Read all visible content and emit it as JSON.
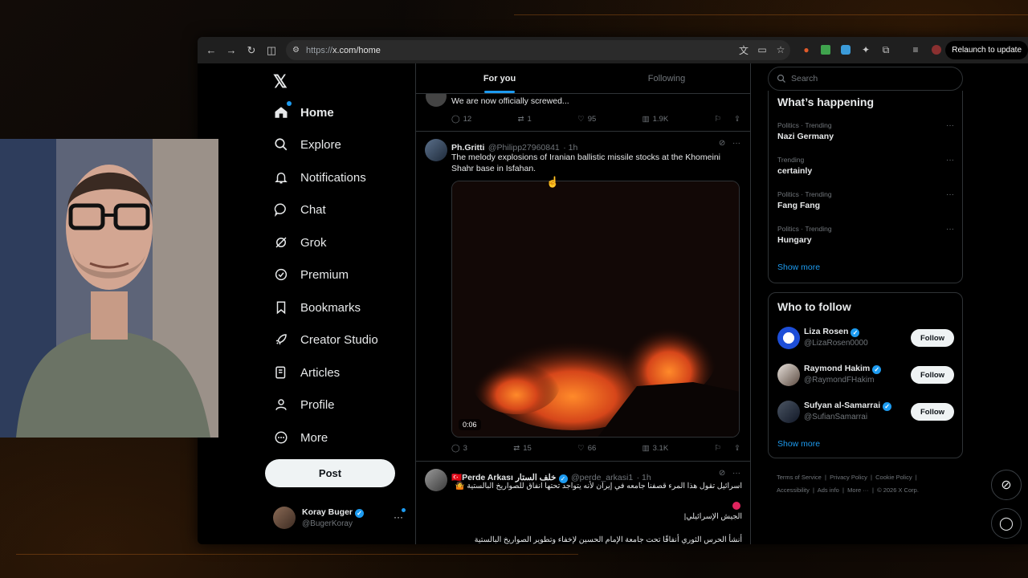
{
  "browser": {
    "url_prefix": "https://",
    "url_main": "x.com/home",
    "relaunch_label": "Relaunch to update"
  },
  "nav": {
    "logo": "𝕏",
    "items": [
      {
        "label": "Home",
        "icon": "home-icon"
      },
      {
        "label": "Explore",
        "icon": "search-icon"
      },
      {
        "label": "Notifications",
        "icon": "bell-icon"
      },
      {
        "label": "Chat",
        "icon": "chat-bubble-icon"
      },
      {
        "label": "Grok",
        "icon": "grok-icon"
      },
      {
        "label": "Premium",
        "icon": "verified-badge-icon"
      },
      {
        "label": "Bookmarks",
        "icon": "bookmark-icon"
      },
      {
        "label": "Creator Studio",
        "icon": "rocket-icon"
      },
      {
        "label": "Articles",
        "icon": "article-icon"
      },
      {
        "label": "Profile",
        "icon": "person-icon"
      },
      {
        "label": "More",
        "icon": "more-circle-icon"
      }
    ],
    "post_label": "Post",
    "account": {
      "name": "Koray Buger",
      "handle": "@BugerKoray"
    }
  },
  "feed": {
    "tabs": [
      "For you",
      "Following"
    ],
    "tweets": [
      {
        "text": "We are now officially screwed...",
        "replies": "12",
        "reposts": "1",
        "likes": "95",
        "views": "1.9K"
      },
      {
        "name": "Ph.Gritti",
        "handle": "@Philipp27960841",
        "time": "· 1h",
        "text": "The melody explosions of Iranian ballistic missile stocks at the Khomeini Shahr base in Isfahan.",
        "video_time": "0:06",
        "replies": "3",
        "reposts": "15",
        "likes": "66",
        "views": "3.1K"
      },
      {
        "name": "🇹🇷Perde Arkası خلف الستار",
        "handle": "@perde_arkasi1",
        "time": "· 1h",
        "line1": "اسرائيل تقول هذا المرء قصفنا جامعه في إيران لأنه يتواجد تحتها انفاق للصواريخ البالستية 🤷",
        "line2": "الجيش الإسرائيلي|",
        "line3": "أنشأ الحرس الثوري أنفاقًا تحت جامعة الإمام الحسين لإخفاء وتطوير الصواريخ البالستية"
      }
    ]
  },
  "sidebar": {
    "search_placeholder": "Search",
    "whats_happening": "What’s happening",
    "trends": [
      {
        "meta": "Politics · Trending",
        "title": "Nazi Germany"
      },
      {
        "meta": "Trending",
        "title": "certainly"
      },
      {
        "meta": "Politics · Trending",
        "title": "Fang Fang"
      },
      {
        "meta": "Politics · Trending",
        "title": "Hungary"
      }
    ],
    "show_more": "Show more",
    "who_to_follow": "Who to follow",
    "follow_label": "Follow",
    "suggestions": [
      {
        "name": "Liza Rosen",
        "handle": "@LizaRosen0000"
      },
      {
        "name": "Raymond Hakim",
        "handle": "@RaymondFHakim"
      },
      {
        "name": "Sufyan al-Samarrai",
        "handle": "@SufianSamarrai"
      }
    ],
    "footer_line1": [
      "Terms of Service",
      "Privacy Policy",
      "Cookie Policy"
    ],
    "footer_line2": [
      "Accessibility",
      "Ads info",
      "More ···",
      "© 2026 X Corp."
    ]
  },
  "colors": {
    "accent": "#1d9bf0",
    "background": "#000000",
    "text": "#e7e9ea",
    "muted": "#71767b"
  }
}
